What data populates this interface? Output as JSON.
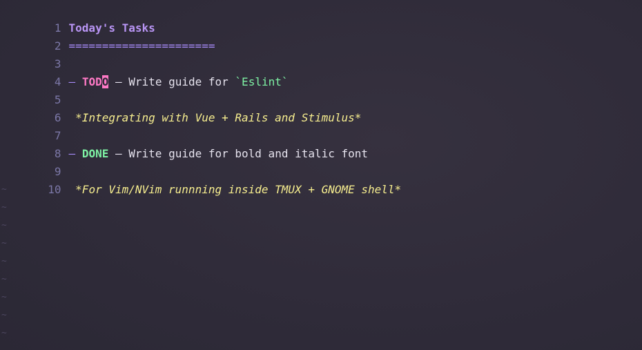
{
  "editor": {
    "line_numbers": [
      "1",
      "2",
      "3",
      "4",
      "5",
      "6",
      "7",
      "8",
      "9",
      "10"
    ],
    "heading": "Today's Tasks",
    "underline": "======================",
    "task1": {
      "bullet": "–",
      "status_prefix": "TOD",
      "status_cursor_char": "O",
      "separator": "–",
      "text": "Write guide for",
      "code": "`Eslint`"
    },
    "note1": "*Integrating with Vue + Rails and Stimulus*",
    "task2": {
      "bullet": "–",
      "status": "DONE",
      "separator": "–",
      "text": "Write guide for bold and italic font"
    },
    "note2": "*For Vim/NVim runnning inside TMUX + GNOME shell*",
    "empty_line_marker": "~",
    "colors": {
      "background": "#2f2b39",
      "line_number": "#7c78a8",
      "heading": "#b995f5",
      "todo": "#ff79c6",
      "done": "#7ef2a4",
      "italic": "#f7ee8f",
      "code": "#7ef2a4"
    }
  }
}
